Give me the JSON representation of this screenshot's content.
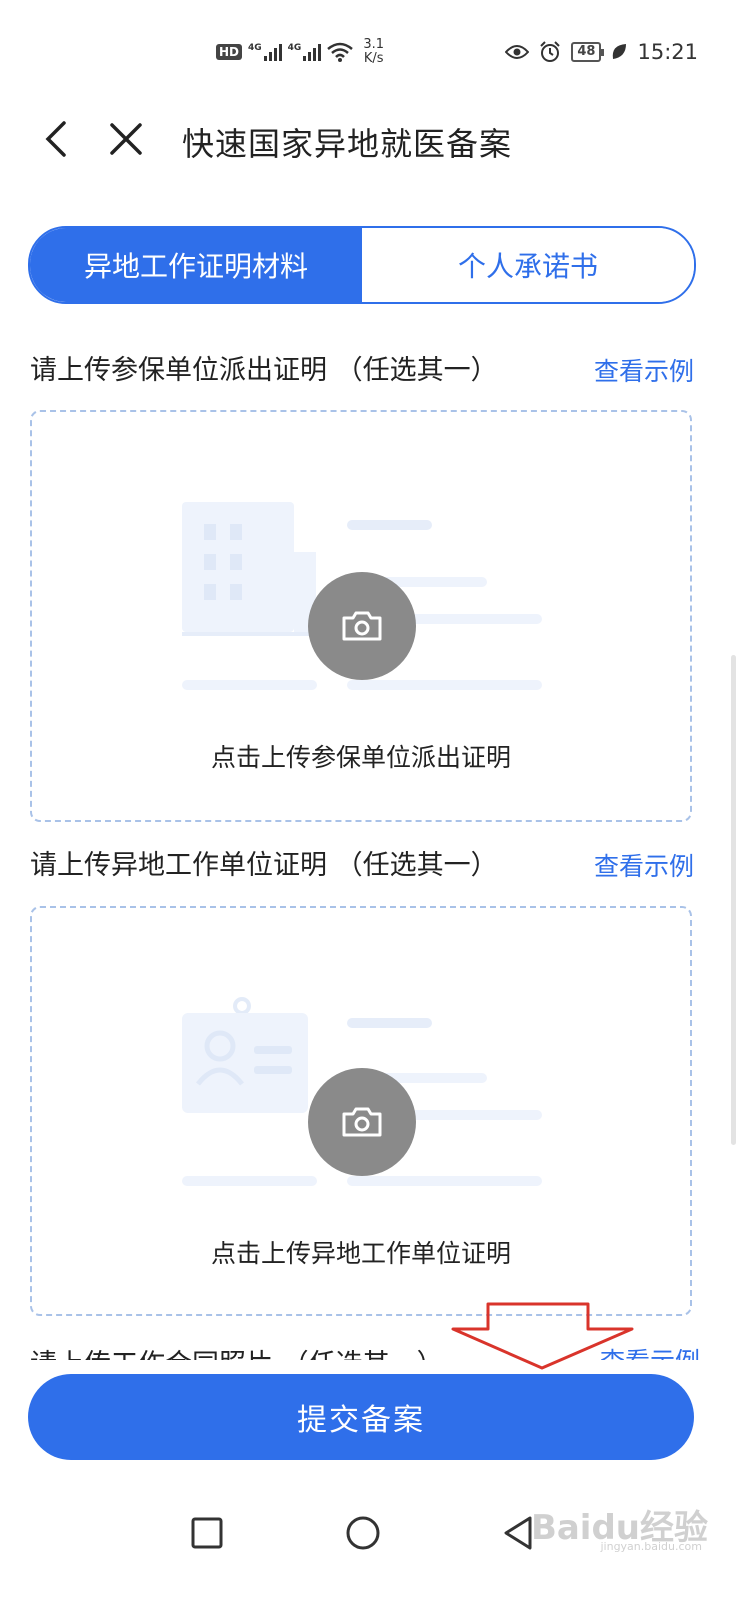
{
  "status_bar": {
    "hd_label": "HD",
    "net1": "4G",
    "net2": "4G",
    "speed_value": "3.1",
    "speed_unit": "K/s",
    "battery": "48",
    "time": "15:21"
  },
  "header": {
    "title": "快速国家异地就医备案"
  },
  "tabs": [
    {
      "label": "异地工作证明材料",
      "active": true
    },
    {
      "label": "个人承诺书",
      "active": false
    }
  ],
  "sections": [
    {
      "title": "请上传参保单位派出证明 （任选其一）",
      "link": "查看示例",
      "caption": "点击上传参保单位派出证明"
    },
    {
      "title": "请上传异地工作单位证明 （任选其一）",
      "link": "查看示例",
      "caption": "点击上传异地工作单位证明"
    },
    {
      "title": "请上传工作合同照片 （任选其一）",
      "link": "查看示例"
    }
  ],
  "submit_label": "提交备案",
  "watermark": {
    "text": "Baidu经验",
    "sub": "jingyan.baidu.com"
  },
  "colors": {
    "accent": "#2f6fea",
    "annotation_arrow": "#d9342b"
  }
}
